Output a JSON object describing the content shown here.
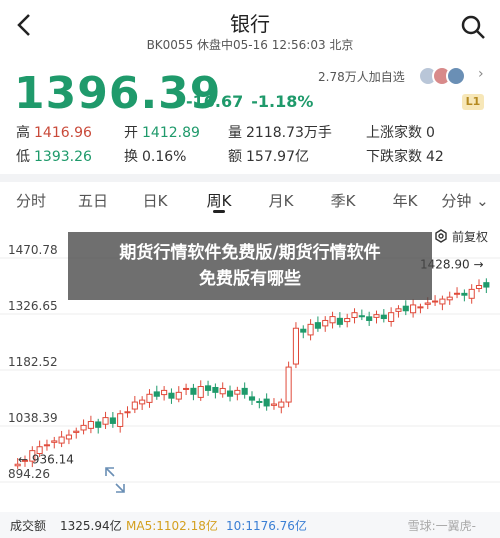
{
  "header": {
    "title": "银行",
    "subtitle": "BK0055 休盘中05-16 12:56:03 北京"
  },
  "quote": {
    "price": "1396.39",
    "change": "-16.67",
    "change_pct": "-1.18%",
    "follow_text": "2.78万人加自选",
    "level_badge": "L1"
  },
  "stats": [
    [
      {
        "k": "高",
        "v": "1416.96",
        "c": "red"
      },
      {
        "k": "开",
        "v": "1412.89",
        "c": "green"
      },
      {
        "k": "量",
        "v": "2118.73万手",
        "c": "dark"
      },
      {
        "k": "上涨家数",
        "v": "0",
        "c": "dark"
      }
    ],
    [
      {
        "k": "低",
        "v": "1393.26",
        "c": "green"
      },
      {
        "k": "换",
        "v": "0.16%",
        "c": "dark"
      },
      {
        "k": "额",
        "v": "157.97亿",
        "c": "dark"
      },
      {
        "k": "下跌家数",
        "v": "42",
        "c": "dark"
      }
    ]
  ],
  "tabs": [
    "分时",
    "五日",
    "日K",
    "周K",
    "月K",
    "季K",
    "年K",
    "分钟"
  ],
  "active_tab": "周K",
  "fuquan_label": "前复权",
  "overlay_text_1": "期货行情软件免费版/期货行情软件",
  "overlay_text_2": "免费版有哪些",
  "chart_data": {
    "type": "candlestick",
    "yticks": [
      "1470.78",
      "1326.65",
      "1182.52",
      "1038.39",
      "894.26"
    ],
    "max_label": "1428.90",
    "min_label": "936.14",
    "ylim": [
      894.26,
      1470.78
    ]
  },
  "bottom": {
    "vol_label": "成交额",
    "vol": "1325.94亿",
    "ma5": "MA5:1102.18亿",
    "ma10": "10:1176.76亿",
    "watermark": "雪球:一翼虎-"
  },
  "colors": {
    "up": "#e04a3a",
    "down": "#1f9a6b"
  }
}
